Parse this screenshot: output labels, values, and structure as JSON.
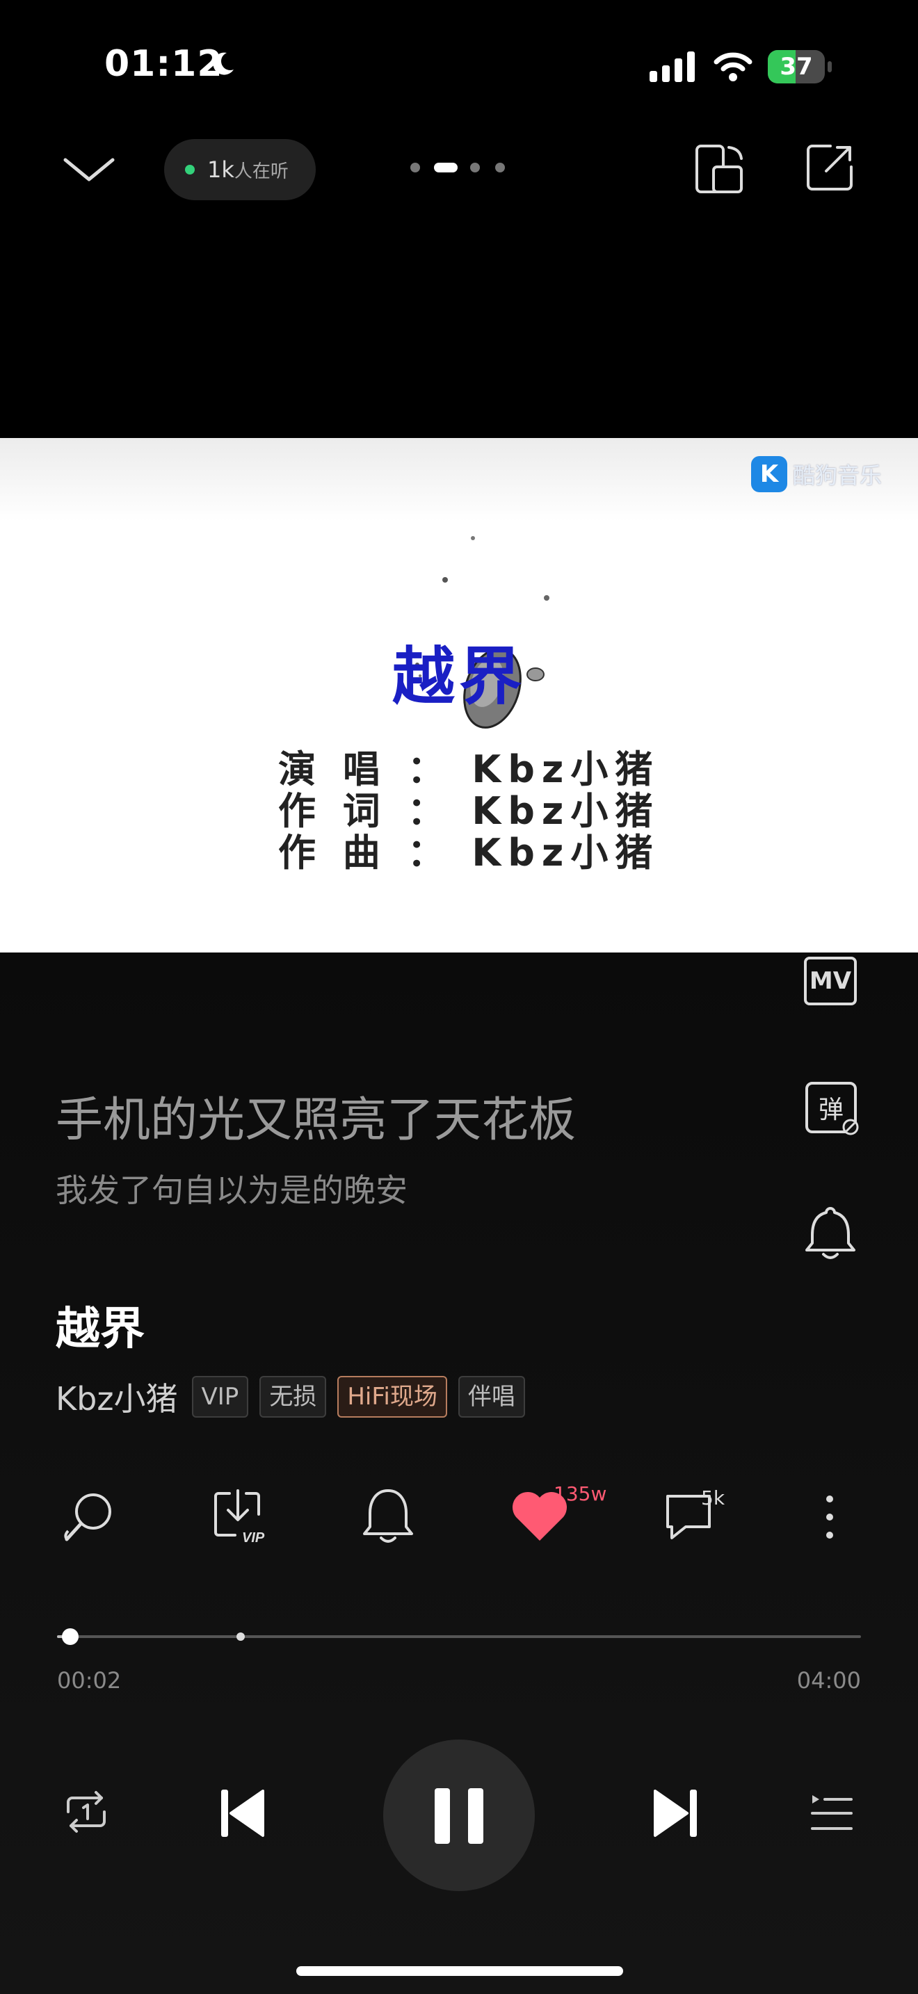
{
  "status_bar": {
    "time": "01:12",
    "battery": "37"
  },
  "header": {
    "listeners_count": "1k",
    "listeners_label": "人在听"
  },
  "video_card": {
    "title": "越界",
    "credits": [
      "演 唱 ： Kbz小猪",
      "作 词 ： Kbz小猪",
      "作 曲 ： Kbz小猪"
    ],
    "watermark": "酷狗音乐",
    "watermark_logo": "K"
  },
  "side_buttons": {
    "mv_label": "MV",
    "danmu_label": "弹"
  },
  "lyrics": {
    "current": "手机的光又照亮了天花板",
    "next": "我发了句自以为是的晚安"
  },
  "song": {
    "title": "越界",
    "artist": "Kbz小猪",
    "tags": [
      "VIP",
      "无损",
      "HiFi现场",
      "伴唱"
    ]
  },
  "actions": {
    "likes": "135w",
    "comments": "5k",
    "download_badge": "VIP"
  },
  "progress": {
    "elapsed": "00:02",
    "total": "04:00",
    "fraction": 0.008
  },
  "colors": {
    "accent_red": "#ff5a73",
    "title_blue": "#1a1fc4",
    "hifi_tag": "#e0a98c",
    "online_green": "#33d17a"
  }
}
